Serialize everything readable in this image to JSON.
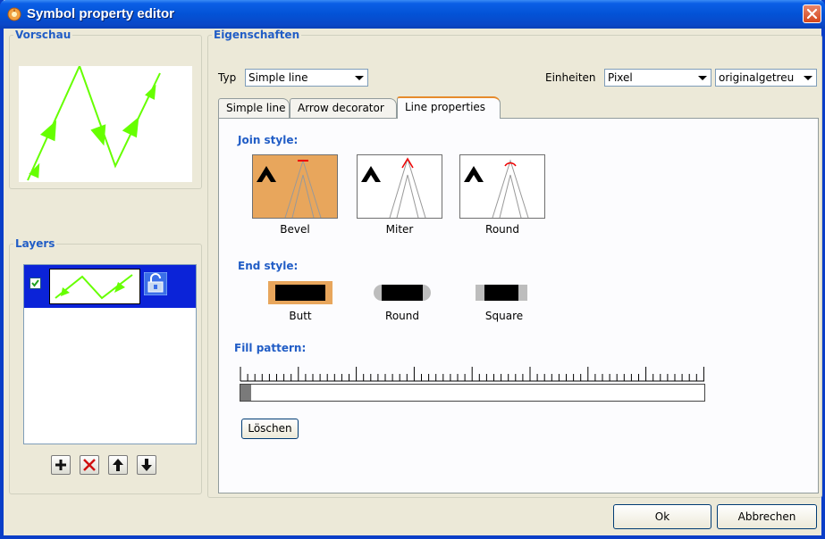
{
  "window": {
    "title": "Symbol property editor",
    "titlebar_color": "#0352d6",
    "close_icon": "close-icon"
  },
  "preview": {
    "legend": "Vorschau",
    "line_color": "#66ff00"
  },
  "layers": {
    "legend": "Layers",
    "items": [
      {
        "checked": true,
        "selected": true,
        "lock_icon": "lock-icon"
      }
    ],
    "toolbar": [
      "add-icon",
      "delete-icon",
      "move-up-icon",
      "move-down-icon"
    ],
    "selection_color": "#0b23d8"
  },
  "properties": {
    "legend": "Eigenschaften",
    "type_label": "Typ",
    "type_value": "Simple line",
    "units_label": "Einheiten",
    "units_value": "Pixel",
    "scale_value": "originalgetreu",
    "tabs": [
      {
        "label": "Simple line",
        "active": false
      },
      {
        "label": "Arrow decorator",
        "active": false
      },
      {
        "label": "Line properties",
        "active": true
      }
    ],
    "join_style": {
      "title": "Join style:",
      "options": [
        {
          "label": "Bevel",
          "selected": true
        },
        {
          "label": "Miter",
          "selected": false
        },
        {
          "label": "Round",
          "selected": false
        }
      ],
      "selected_color": "#e8a65c"
    },
    "end_style": {
      "title": "End style:",
      "options": [
        {
          "label": "Butt",
          "selected": true
        },
        {
          "label": "Round",
          "selected": false
        },
        {
          "label": "Square",
          "selected": false
        }
      ]
    },
    "fill_pattern": {
      "title": "Fill pattern:",
      "clear_button": "Löschen"
    }
  },
  "footer": {
    "ok_button": "Ok",
    "cancel_button": "Abbrechen"
  },
  "accent_color": "#215dc6"
}
